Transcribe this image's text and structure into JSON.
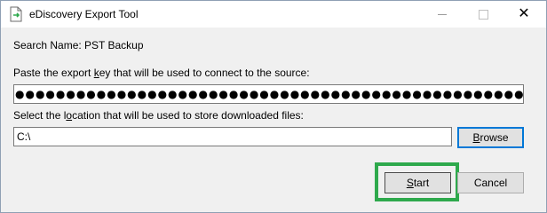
{
  "window": {
    "title": "eDiscovery Export Tool",
    "controls": {
      "minimize_icon": "minimize-icon",
      "maximize_icon": "maximize-icon",
      "close_icon": "close-icon",
      "close_glyph": "✕"
    }
  },
  "form": {
    "search_name_label": "Search Name: PST Backup",
    "export_key": {
      "label_before": "Paste the export ",
      "label_accel": "k",
      "label_after": "ey that will be used to connect to the source:",
      "masked_value": "●●●●●●●●●●●●●●●●●●●●●●●●●●●●●●●●●●●●●●●●●●●●●●●●●●●●●●●●●●●●●●●●●●●●●●●●"
    },
    "location": {
      "label_before": "Select the l",
      "label_accel": "o",
      "label_after": "cation that will be used to store downloaded files:",
      "value": "C:\\"
    },
    "browse_button": {
      "accel": "B",
      "rest": "rowse"
    },
    "start_button": {
      "accel": "S",
      "rest": "tart"
    },
    "cancel_button": {
      "label": "Cancel"
    }
  },
  "colors": {
    "highlight": "#2ea94c",
    "focus_border": "#0078d7"
  }
}
